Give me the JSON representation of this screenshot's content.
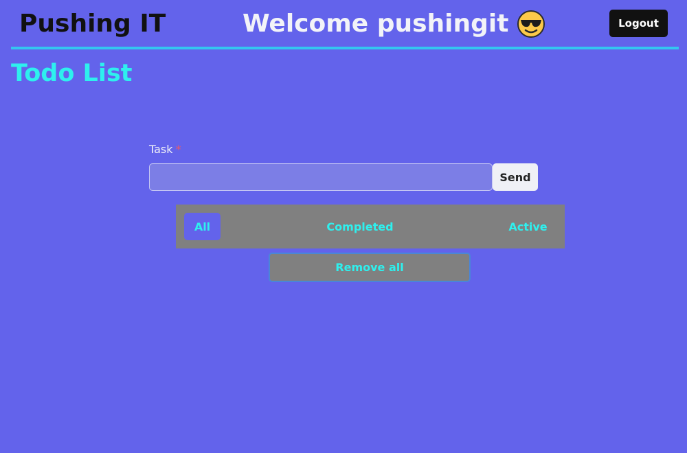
{
  "header": {
    "brand": "Pushing IT",
    "welcome": "Welcome pushingit",
    "emoji_icon": "sunglasses-face-icon",
    "logout_label": "Logout"
  },
  "page": {
    "title": "Todo List"
  },
  "form": {
    "task_label": "Task",
    "required_mark": "*",
    "task_value": "",
    "send_label": "Send"
  },
  "filters": {
    "all": "All",
    "completed": "Completed",
    "active": "Active",
    "selected": "All"
  },
  "actions": {
    "remove_all_label": "Remove all"
  },
  "colors": {
    "background": "#6363eb",
    "accent_cyan": "#2ef0ee",
    "header_border": "#34c6f0",
    "filter_bar": "#808080",
    "logout_bg": "#111111"
  }
}
